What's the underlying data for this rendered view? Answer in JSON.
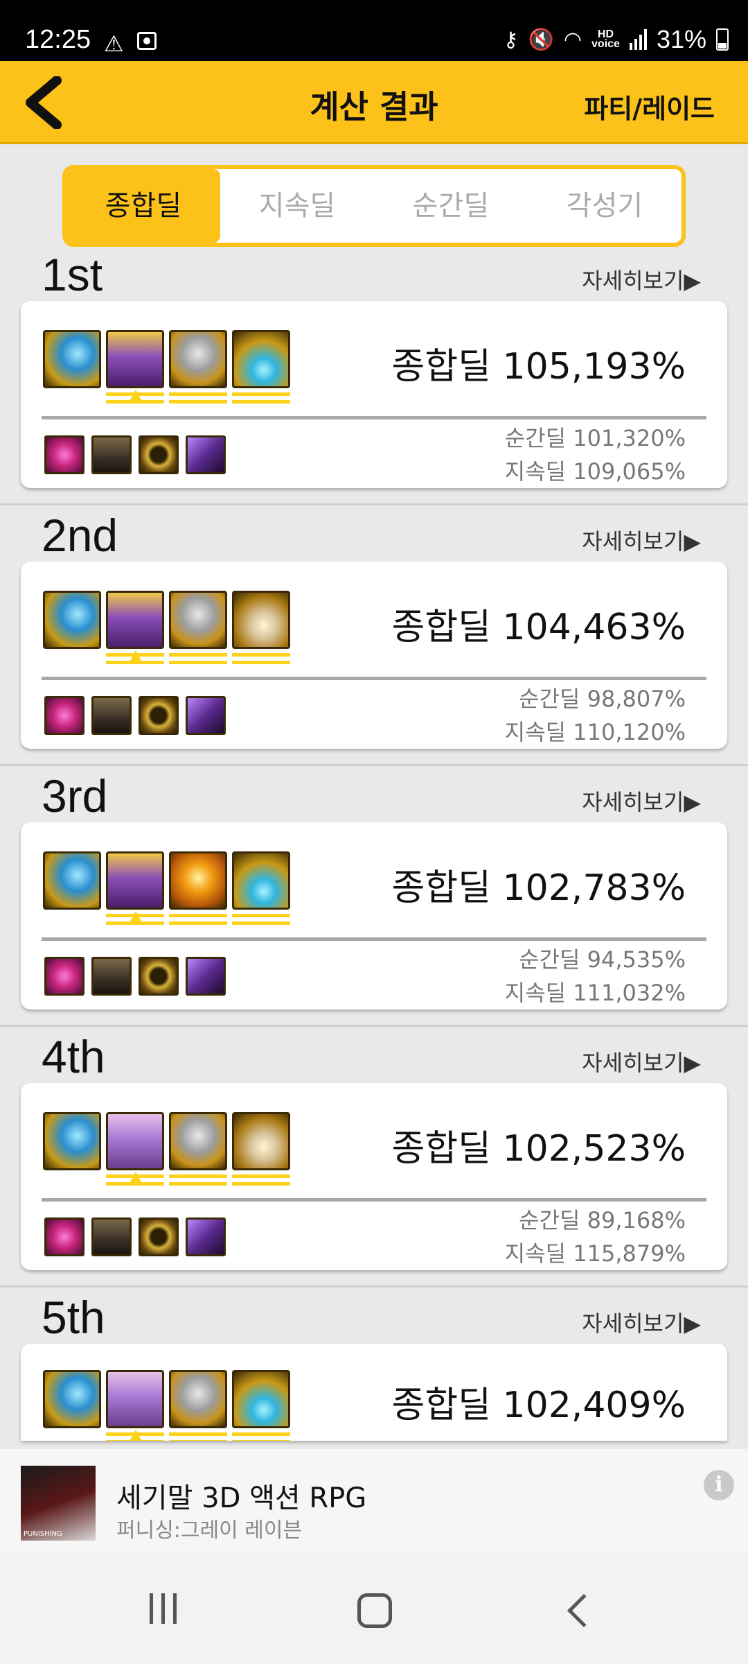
{
  "status_bar": {
    "time": "12:25",
    "battery": "31%",
    "hd_label": "HD\nvoice"
  },
  "header": {
    "title": "계산 결과",
    "right_action": "파티/레이드"
  },
  "tabs": [
    {
      "label": "종합딜",
      "active": true
    },
    {
      "label": "지속딜",
      "active": false
    },
    {
      "label": "순간딜",
      "active": false
    },
    {
      "label": "각성기",
      "active": false
    }
  ],
  "results": [
    {
      "rank": "1st",
      "detail": "자세히보기▶",
      "total": "종합딜 105,193%",
      "burst": "순간딜 101,320%",
      "sustain": "지속딜 109,065%"
    },
    {
      "rank": "2nd",
      "detail": "자세히보기▶",
      "total": "종합딜 104,463%",
      "burst": "순간딜 98,807%",
      "sustain": "지속딜 110,120%"
    },
    {
      "rank": "3rd",
      "detail": "자세히보기▶",
      "total": "종합딜 102,783%",
      "burst": "순간딜 94,535%",
      "sustain": "지속딜 111,032%"
    },
    {
      "rank": "4th",
      "detail": "자세히보기▶",
      "total": "종합딜 102,523%",
      "burst": "순간딜 89,168%",
      "sustain": "지속딜 115,879%"
    },
    {
      "rank": "5th",
      "detail": "자세히보기▶",
      "total": "종합딜 102,409%"
    }
  ],
  "ad": {
    "title": "세기말 3D 액션 RPG",
    "subtitle": "퍼니싱:그레이 레이븐",
    "thumb_text": "PUNISHING",
    "info": "i"
  },
  "colors": {
    "accent": "#fcc21a",
    "background": "#e9e9e9"
  }
}
